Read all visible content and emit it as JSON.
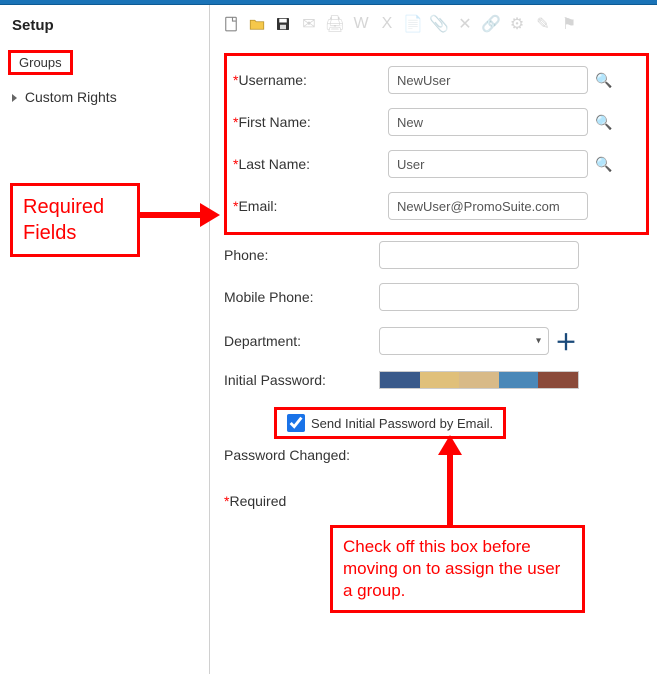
{
  "sidebar": {
    "title": "Setup",
    "items": [
      {
        "label": "Groups"
      },
      {
        "label": "Custom Rights"
      }
    ]
  },
  "toolbar": {
    "new_tip": "New",
    "open_tip": "Open",
    "save_tip": "Save"
  },
  "form": {
    "username_label": "Username:",
    "username_value": "NewUser",
    "firstname_label": "First Name:",
    "firstname_value": "New",
    "lastname_label": "Last Name:",
    "lastname_value": "User",
    "email_label": "Email:",
    "email_value": "NewUser@PromoSuite.com",
    "phone_label": "Phone:",
    "phone_value": "",
    "mobile_label": "Mobile Phone:",
    "mobile_value": "",
    "department_label": "Department:",
    "department_value": "",
    "initialpw_label": "Initial Password:",
    "sendpw_label": "Send Initial Password by Email.",
    "sendpw_checked": true,
    "pwchanged_label": "Password Changed:",
    "pwchanged_value": "",
    "required_footnote": "Required"
  },
  "annotations": {
    "required": "Required Fields",
    "checkbox_note": "Check off this box before moving on to assign the user a group."
  }
}
